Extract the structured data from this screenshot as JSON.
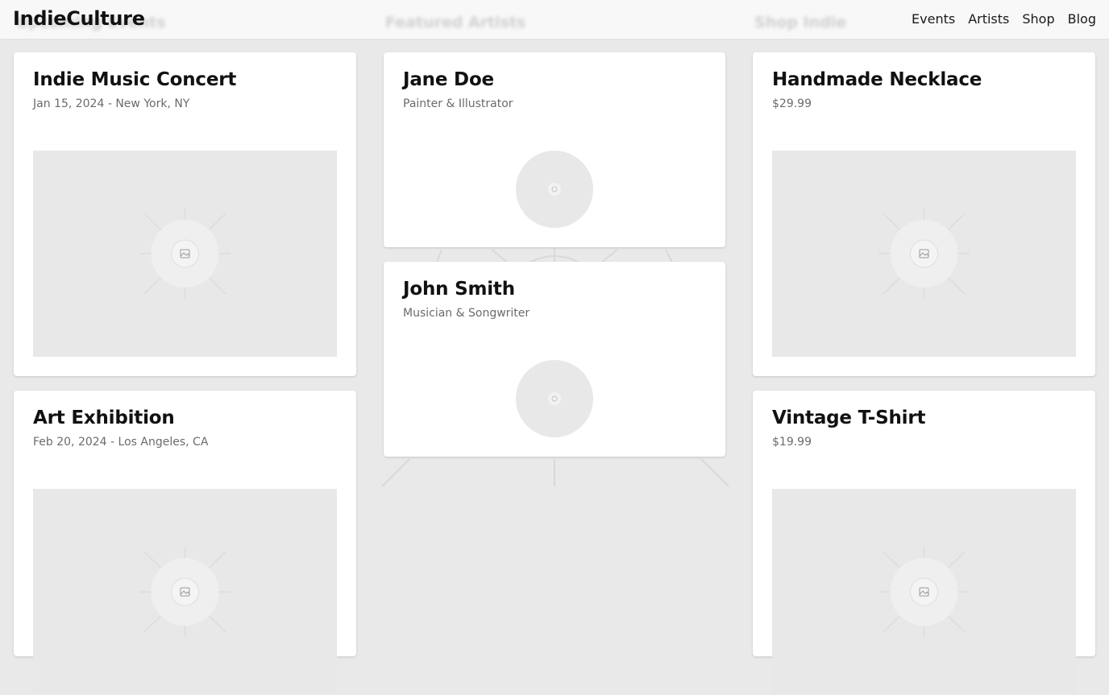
{
  "header": {
    "brand": "IndieCulture",
    "nav": [
      "Events",
      "Artists",
      "Shop",
      "Blog"
    ]
  },
  "events": [
    {
      "title": "Indie Music Concert",
      "meta": "Jan 15, 2024 - New York, NY"
    },
    {
      "title": "Art Exhibition",
      "meta": "Feb 20, 2024 - Los Angeles, CA"
    }
  ],
  "artists": [
    {
      "name": "Jane Doe",
      "role": "Painter & Illustrator"
    },
    {
      "name": "John Smith",
      "role": "Musician & Songwriter"
    }
  ],
  "products": [
    {
      "name": "Handmade Necklace",
      "price": "$29.99"
    },
    {
      "name": "Vintage T-Shirt",
      "price": "$19.99"
    }
  ],
  "icons": {
    "image_placeholder": "image-icon",
    "avatar_placeholder": "avatar-icon"
  },
  "colors": {
    "page_bg": "#e9e9e9",
    "card_bg": "#ffffff",
    "placeholder_bg": "#e8e8e8",
    "text": "#111111",
    "muted": "#6b6b6b"
  }
}
